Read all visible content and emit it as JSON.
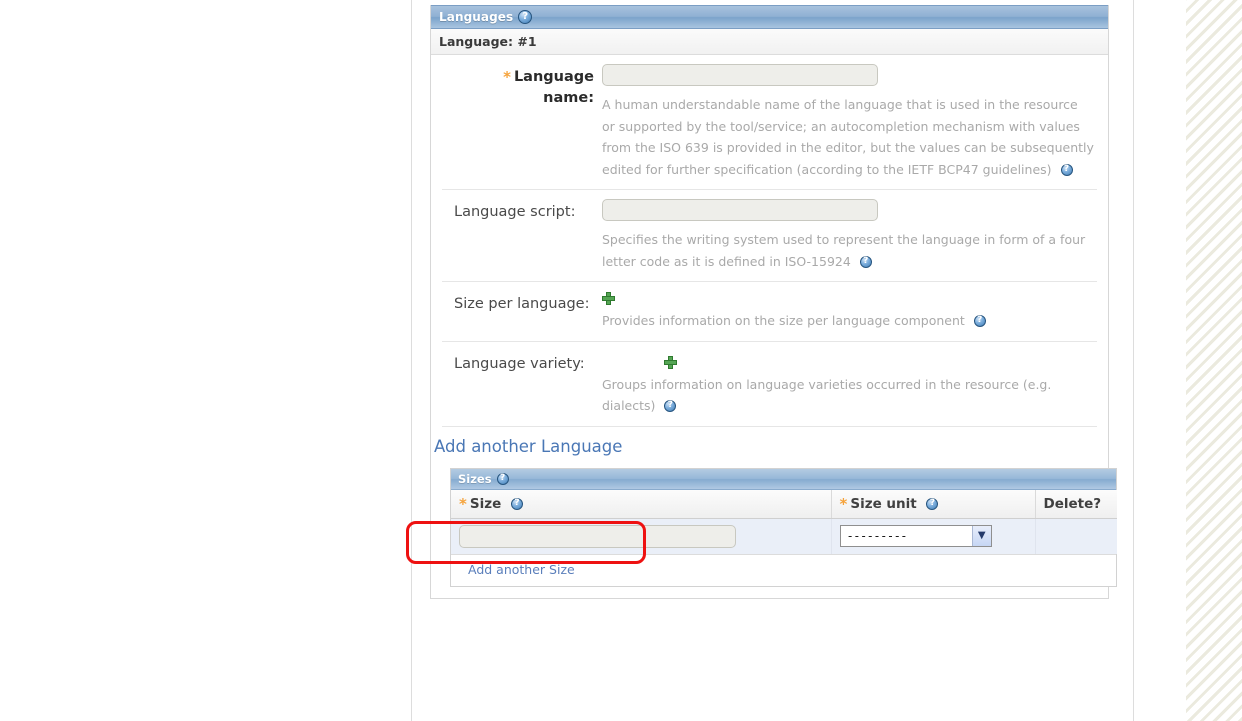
{
  "panel": {
    "title": "Languages",
    "help_icon": "help-question-icon",
    "sub_header": "Language: #1"
  },
  "fields": [
    {
      "label": "Language name:",
      "required": true,
      "required_marker": "*",
      "input_value": "",
      "help": "A human understandable name of the language that is used in the resource or supported by the tool/service; an autocompletion mechanism with values from the ISO 639 is provided in the editor, but the values can be subsequently edited for further specification (according to the IETF BCP47 guidelines)"
    },
    {
      "label": "Language script:",
      "required": false,
      "input_value": "",
      "help": "Specifies the writing system used to represent the language in form of a four letter code as it is defined in ISO-15924"
    },
    {
      "label": "Size per language:",
      "required": false,
      "add_icon": "green-plus-icon",
      "help": "Provides information on the size per language component"
    },
    {
      "label": "Language variety:",
      "required": false,
      "add_icon": "green-plus-icon",
      "help": "Groups information on language varieties occurred in the resource (e.g. dialects)"
    }
  ],
  "add_language_link": "Add another Language",
  "sizes": {
    "title": "Sizes",
    "columns": [
      {
        "label": "Size",
        "required": true,
        "required_marker": "*",
        "has_help": true
      },
      {
        "label": "Size unit",
        "required": true,
        "required_marker": "*",
        "has_help": true
      },
      {
        "label": "Delete?",
        "required": false,
        "has_help": false
      }
    ],
    "rows": [
      {
        "size_value": "",
        "unit_selected": "---------",
        "unit_options": [
          "---------"
        ],
        "delete_checked": false
      }
    ],
    "add_size_link": "Add another Size"
  },
  "annotation": {
    "shape": "rounded-rectangle",
    "color": "#ee1111",
    "targets": "add_language_link"
  },
  "colors": {
    "panel_header_blue": "#8fb0d3",
    "required_asterisk": "#f5a33c",
    "link_blue": "#4a77b5",
    "help_text_gray": "#a9a9a9",
    "plus_green": "#55a554",
    "table_row_bg": "#eaeff8",
    "annotation_red": "#ee1111"
  }
}
